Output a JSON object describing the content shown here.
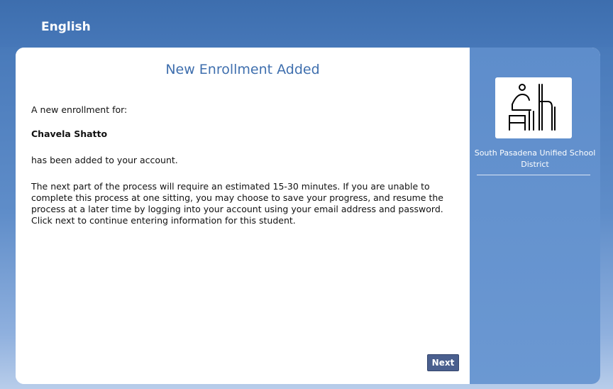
{
  "header": {
    "language_link": "English"
  },
  "main": {
    "title": "New Enrollment Added",
    "intro": "A new enrollment for:",
    "student_name": "Chavela Shatto",
    "added_text": "has been added to your account.",
    "instructions": "The next part of the process will require an estimated 15-30 minutes. If you are unable to complete this process at one sitting, you may choose to save your progress, and resume the process at a later time by logging into your account using your email address and password. Click next to continue entering information for this student.",
    "next_button": "Next"
  },
  "sidebar": {
    "logo_icon": "student-at-desk-icon",
    "district_name": "South Pasadena Unified School District"
  },
  "colors": {
    "header_blue": "#3f6fae",
    "sidebar_blue": "#6391ce",
    "title_blue": "#3f6fae",
    "button_navy": "#4a5f8e"
  }
}
